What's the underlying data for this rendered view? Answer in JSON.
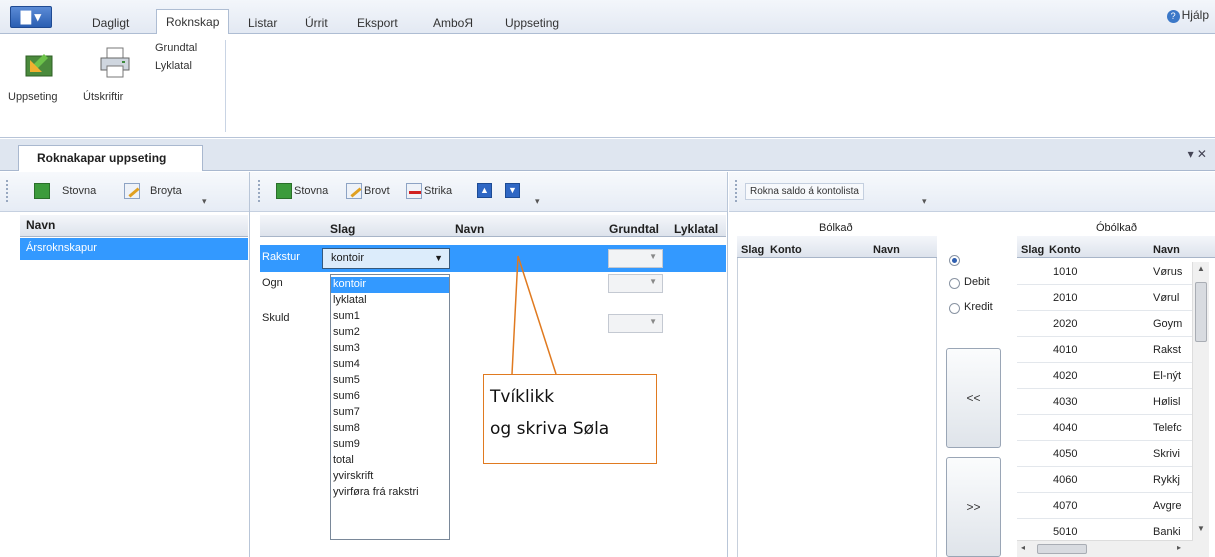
{
  "ribbon": {
    "app_button": "▇ ▾",
    "tabs": [
      "Dagligt",
      "Roknskap",
      "Listar",
      "Úrrit",
      "Eksport",
      "AmboЯ",
      "Uppseting"
    ],
    "help": "Hjálp",
    "buttons": {
      "uppseting": "Uppseting",
      "utskriftir": "Útskriftir"
    },
    "menu_items": [
      "Grundtal",
      "Lyklatal"
    ]
  },
  "doc_tab": {
    "title": "Roknakapar uppseting",
    "controls": "▾ ✕"
  },
  "left_panel": {
    "toolbar": {
      "add": "Stovna",
      "edit": "Broyta"
    },
    "header": "Navn",
    "rows": [
      "Ársroknskapur"
    ]
  },
  "middle_panel": {
    "toolbar": {
      "add": "Stovna",
      "edit": "Brovt",
      "delete": "Strika"
    },
    "headers": {
      "slag": "Slag",
      "navn": "Navn",
      "grundtal": "Grundtal",
      "lyklatal": "Lyklatal"
    },
    "rows": [
      {
        "label": "Rakstur",
        "slag": "kontoir"
      },
      {
        "label": "Ogn",
        "slag": ""
      },
      {
        "label": "Skuld",
        "slag": ""
      }
    ],
    "dropdown": [
      "kontoir",
      "lyklatal",
      "sum1",
      "sum2",
      "sum3",
      "sum4",
      "sum5",
      "sum6",
      "sum7",
      "sum8",
      "sum9",
      "total",
      "yvirskrift",
      "yvirføra frá rakstri"
    ],
    "dropdown_selected": 0
  },
  "callout": {
    "line1": "Tvíklikk",
    "line2": "og skriva Søla"
  },
  "right_panel": {
    "toolbar": {
      "button": "Rokna saldo á kontolista"
    },
    "grouped": {
      "title": "Bólkað",
      "headers": {
        "slag": "Slag",
        "konto": "Konto",
        "navn": "Navn"
      }
    },
    "radios": {
      "all": "",
      "debit": "Debit",
      "kredit": "Kredit",
      "selected": "all"
    },
    "move_left": "<<",
    "move_right": ">>",
    "ungrouped": {
      "title": "Óbólkað",
      "headers": {
        "slag": "Slag",
        "konto": "Konto",
        "navn": "Navn"
      },
      "rows": [
        {
          "konto": "1010",
          "navn": "Vørus"
        },
        {
          "konto": "2010",
          "navn": "Vørul"
        },
        {
          "konto": "2020",
          "navn": "Goym"
        },
        {
          "konto": "4010",
          "navn": "Rakst"
        },
        {
          "konto": "4020",
          "navn": "El-nýt"
        },
        {
          "konto": "4030",
          "navn": "Hølisl"
        },
        {
          "konto": "4040",
          "navn": "Telefc"
        },
        {
          "konto": "4050",
          "navn": "Skrivi"
        },
        {
          "konto": "4060",
          "navn": "Rykkj"
        },
        {
          "konto": "4070",
          "navn": "Avgre"
        },
        {
          "konto": "5010",
          "navn": "Banki"
        }
      ]
    }
  },
  "colors": {
    "selection": "#3399ff",
    "callout_border": "#e07a20",
    "accent": "#2f5fb0"
  }
}
